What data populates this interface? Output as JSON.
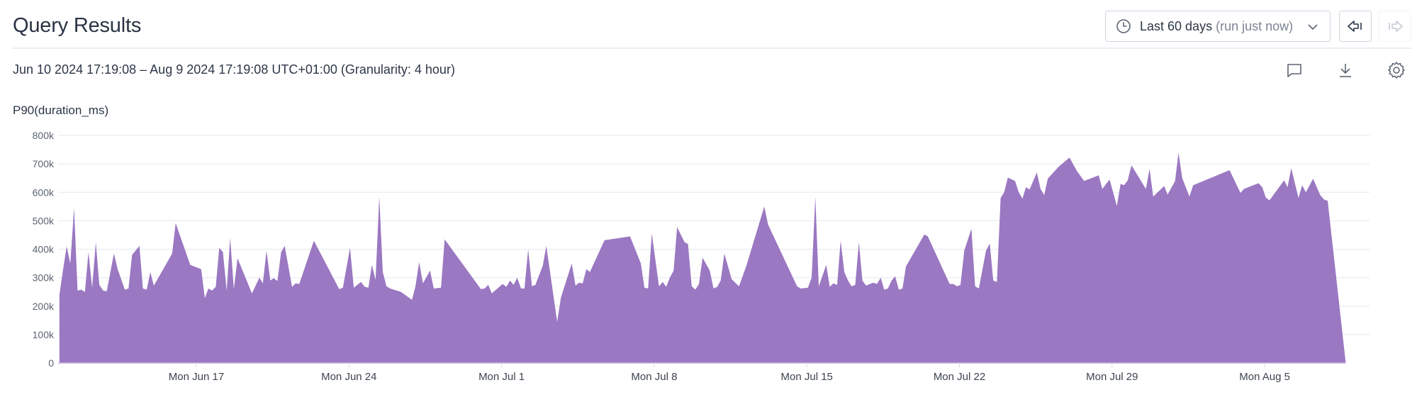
{
  "header": {
    "title": "Query Results",
    "time_picker": {
      "label": "Last 60 days",
      "sub": "(run just now)"
    },
    "icons": {
      "clock": "clock-icon",
      "chevron": "chevron-down-icon",
      "back": "step-back-icon",
      "forward": "step-forward-icon"
    }
  },
  "subheader": {
    "range_text": "Jun 10 2024 17:19:08 – Aug 9 2024 17:19:08 UTC+01:00 (Granularity: 4 hour)",
    "actions": [
      "comment-icon",
      "download-icon",
      "settings-icon"
    ]
  },
  "colors": {
    "area": "#9b78c2",
    "grid": "#e9ecf3",
    "axis": "#d8dce6"
  },
  "chart_data": {
    "type": "area",
    "title": "P90(duration_ms)",
    "xlabel": "",
    "ylabel": "P90(duration_ms)",
    "x_units": "days since Jun 10 2024 17:19",
    "x_range": [
      0,
      60
    ],
    "ylim": [
      0,
      800000
    ],
    "yticks": [
      0,
      100000,
      200000,
      300000,
      400000,
      500000,
      600000,
      700000,
      800000
    ],
    "ytick_labels": [
      "0",
      "100k",
      "200k",
      "300k",
      "400k",
      "500k",
      "600k",
      "700k",
      "800k"
    ],
    "xticks": [
      6.28,
      13.28,
      20.28,
      27.28,
      34.28,
      41.28,
      48.28,
      55.28
    ],
    "xtick_labels": [
      "Mon Jun 17",
      "Mon Jun 24",
      "Mon Jul 1",
      "Mon Jul 8",
      "Mon Jul 15",
      "Mon Jul 22",
      "Mon Jul 29",
      "Mon Aug 5"
    ],
    "grid": true,
    "legend": "none",
    "series": [
      {
        "name": "P90(duration_ms)",
        "points": [
          [
            0.0,
            240000
          ],
          [
            0.17,
            330000
          ],
          [
            0.33,
            410000
          ],
          [
            0.5,
            350000
          ],
          [
            0.67,
            545000
          ],
          [
            0.83,
            255000
          ],
          [
            1.0,
            258000
          ],
          [
            1.17,
            250000
          ],
          [
            1.33,
            390000
          ],
          [
            1.5,
            265000
          ],
          [
            1.67,
            425000
          ],
          [
            1.83,
            275000
          ],
          [
            2.0,
            255000
          ],
          [
            2.17,
            252000
          ],
          [
            2.5,
            385000
          ],
          [
            2.67,
            330000
          ],
          [
            3.0,
            258000
          ],
          [
            3.17,
            262000
          ],
          [
            3.33,
            380000
          ],
          [
            3.67,
            412000
          ],
          [
            3.83,
            262000
          ],
          [
            4.0,
            258000
          ],
          [
            4.17,
            320000
          ],
          [
            4.33,
            272000
          ],
          [
            5.17,
            385000
          ],
          [
            5.33,
            492000
          ],
          [
            6.0,
            345000
          ],
          [
            6.5,
            330000
          ],
          [
            6.67,
            228000
          ],
          [
            6.83,
            262000
          ],
          [
            7.0,
            255000
          ],
          [
            7.17,
            268000
          ],
          [
            7.33,
            405000
          ],
          [
            7.5,
            390000
          ],
          [
            7.67,
            255000
          ],
          [
            7.83,
            440000
          ],
          [
            8.0,
            260000
          ],
          [
            8.17,
            368000
          ],
          [
            8.83,
            245000
          ],
          [
            9.17,
            300000
          ],
          [
            9.33,
            280000
          ],
          [
            9.5,
            395000
          ],
          [
            9.67,
            290000
          ],
          [
            9.83,
            298000
          ],
          [
            10.0,
            288000
          ],
          [
            10.17,
            390000
          ],
          [
            10.33,
            412000
          ],
          [
            10.67,
            268000
          ],
          [
            10.83,
            280000
          ],
          [
            11.0,
            278000
          ],
          [
            11.67,
            430000
          ],
          [
            12.83,
            260000
          ],
          [
            13.0,
            265000
          ],
          [
            13.33,
            405000
          ],
          [
            13.5,
            265000
          ],
          [
            13.83,
            285000
          ],
          [
            14.0,
            268000
          ],
          [
            14.17,
            265000
          ],
          [
            14.33,
            345000
          ],
          [
            14.5,
            292000
          ],
          [
            14.67,
            585000
          ],
          [
            14.83,
            320000
          ],
          [
            15.0,
            270000
          ],
          [
            15.17,
            262000
          ],
          [
            15.67,
            250000
          ],
          [
            16.17,
            222000
          ],
          [
            16.33,
            270000
          ],
          [
            16.5,
            355000
          ],
          [
            16.67,
            280000
          ],
          [
            17.0,
            325000
          ],
          [
            17.17,
            262000
          ],
          [
            17.5,
            265000
          ],
          [
            17.67,
            435000
          ],
          [
            19.33,
            260000
          ],
          [
            19.5,
            262000
          ],
          [
            19.67,
            275000
          ],
          [
            19.83,
            245000
          ],
          [
            20.33,
            278000
          ],
          [
            20.5,
            268000
          ],
          [
            20.67,
            290000
          ],
          [
            20.83,
            275000
          ],
          [
            21.0,
            300000
          ],
          [
            21.17,
            262000
          ],
          [
            21.33,
            262000
          ],
          [
            21.5,
            400000
          ],
          [
            21.67,
            270000
          ],
          [
            21.83,
            275000
          ],
          [
            22.17,
            342000
          ],
          [
            22.33,
            412000
          ],
          [
            22.83,
            145000
          ],
          [
            23.0,
            230000
          ],
          [
            23.5,
            350000
          ],
          [
            23.67,
            272000
          ],
          [
            23.83,
            282000
          ],
          [
            24.0,
            280000
          ],
          [
            24.17,
            330000
          ],
          [
            24.33,
            320000
          ],
          [
            25.0,
            432000
          ],
          [
            26.17,
            445000
          ],
          [
            26.67,
            350000
          ],
          [
            26.83,
            265000
          ],
          [
            27.0,
            262000
          ],
          [
            27.17,
            455000
          ],
          [
            27.5,
            270000
          ],
          [
            27.67,
            285000
          ],
          [
            27.83,
            268000
          ],
          [
            28.0,
            300000
          ],
          [
            28.17,
            325000
          ],
          [
            28.33,
            478000
          ],
          [
            28.67,
            425000
          ],
          [
            28.83,
            418000
          ],
          [
            29.0,
            270000
          ],
          [
            29.17,
            258000
          ],
          [
            29.33,
            278000
          ],
          [
            29.5,
            370000
          ],
          [
            29.83,
            325000
          ],
          [
            30.0,
            262000
          ],
          [
            30.17,
            268000
          ],
          [
            30.33,
            290000
          ],
          [
            30.5,
            385000
          ],
          [
            30.83,
            295000
          ],
          [
            31.17,
            270000
          ],
          [
            31.5,
            340000
          ],
          [
            32.33,
            550000
          ],
          [
            32.5,
            487000
          ],
          [
            33.83,
            270000
          ],
          [
            34.0,
            262000
          ],
          [
            34.33,
            265000
          ],
          [
            34.5,
            300000
          ],
          [
            34.67,
            585000
          ],
          [
            34.83,
            270000
          ],
          [
            35.17,
            345000
          ],
          [
            35.33,
            268000
          ],
          [
            35.5,
            280000
          ],
          [
            35.67,
            275000
          ],
          [
            35.83,
            430000
          ],
          [
            36.0,
            320000
          ],
          [
            36.17,
            290000
          ],
          [
            36.33,
            270000
          ],
          [
            36.5,
            275000
          ],
          [
            36.67,
            425000
          ],
          [
            36.83,
            290000
          ],
          [
            37.0,
            272000
          ],
          [
            37.17,
            278000
          ],
          [
            37.33,
            282000
          ],
          [
            37.5,
            278000
          ],
          [
            37.67,
            300000
          ],
          [
            37.83,
            258000
          ],
          [
            38.0,
            262000
          ],
          [
            38.17,
            290000
          ],
          [
            38.33,
            305000
          ],
          [
            38.5,
            258000
          ],
          [
            38.67,
            262000
          ],
          [
            38.83,
            340000
          ],
          [
            39.67,
            452000
          ],
          [
            39.83,
            445000
          ],
          [
            40.83,
            278000
          ],
          [
            41.0,
            278000
          ],
          [
            41.17,
            270000
          ],
          [
            41.33,
            275000
          ],
          [
            41.5,
            395000
          ],
          [
            41.83,
            472000
          ],
          [
            42.0,
            270000
          ],
          [
            42.17,
            262000
          ],
          [
            42.5,
            395000
          ],
          [
            42.67,
            420000
          ],
          [
            42.83,
            290000
          ],
          [
            43.0,
            285000
          ],
          [
            43.17,
            580000
          ],
          [
            43.33,
            600000
          ],
          [
            43.5,
            652000
          ],
          [
            43.83,
            640000
          ],
          [
            44.0,
            600000
          ],
          [
            44.17,
            578000
          ],
          [
            44.33,
            618000
          ],
          [
            44.5,
            610000
          ],
          [
            44.83,
            670000
          ],
          [
            45.0,
            612000
          ],
          [
            45.17,
            590000
          ],
          [
            45.33,
            648000
          ],
          [
            45.83,
            690000
          ],
          [
            46.33,
            722000
          ],
          [
            46.67,
            675000
          ],
          [
            47.0,
            640000
          ],
          [
            47.67,
            660000
          ],
          [
            47.83,
            612000
          ],
          [
            48.17,
            645000
          ],
          [
            48.5,
            552000
          ],
          [
            48.67,
            630000
          ],
          [
            48.83,
            625000
          ],
          [
            49.0,
            642000
          ],
          [
            49.17,
            695000
          ],
          [
            49.83,
            612000
          ],
          [
            50.0,
            682000
          ],
          [
            50.17,
            585000
          ],
          [
            50.67,
            622000
          ],
          [
            50.83,
            592000
          ],
          [
            51.17,
            640000
          ],
          [
            51.33,
            740000
          ],
          [
            51.5,
            650000
          ],
          [
            51.83,
            585000
          ],
          [
            52.0,
            625000
          ],
          [
            53.67,
            678000
          ],
          [
            54.17,
            598000
          ],
          [
            54.33,
            612000
          ],
          [
            55.0,
            632000
          ],
          [
            55.17,
            618000
          ],
          [
            55.33,
            582000
          ],
          [
            55.5,
            572000
          ],
          [
            56.17,
            642000
          ],
          [
            56.33,
            618000
          ],
          [
            56.5,
            685000
          ],
          [
            56.83,
            580000
          ],
          [
            57.0,
            625000
          ],
          [
            57.17,
            600000
          ],
          [
            57.5,
            648000
          ],
          [
            57.83,
            590000
          ],
          [
            58.0,
            575000
          ],
          [
            58.17,
            570000
          ],
          [
            59.0,
            0
          ]
        ]
      }
    ]
  }
}
